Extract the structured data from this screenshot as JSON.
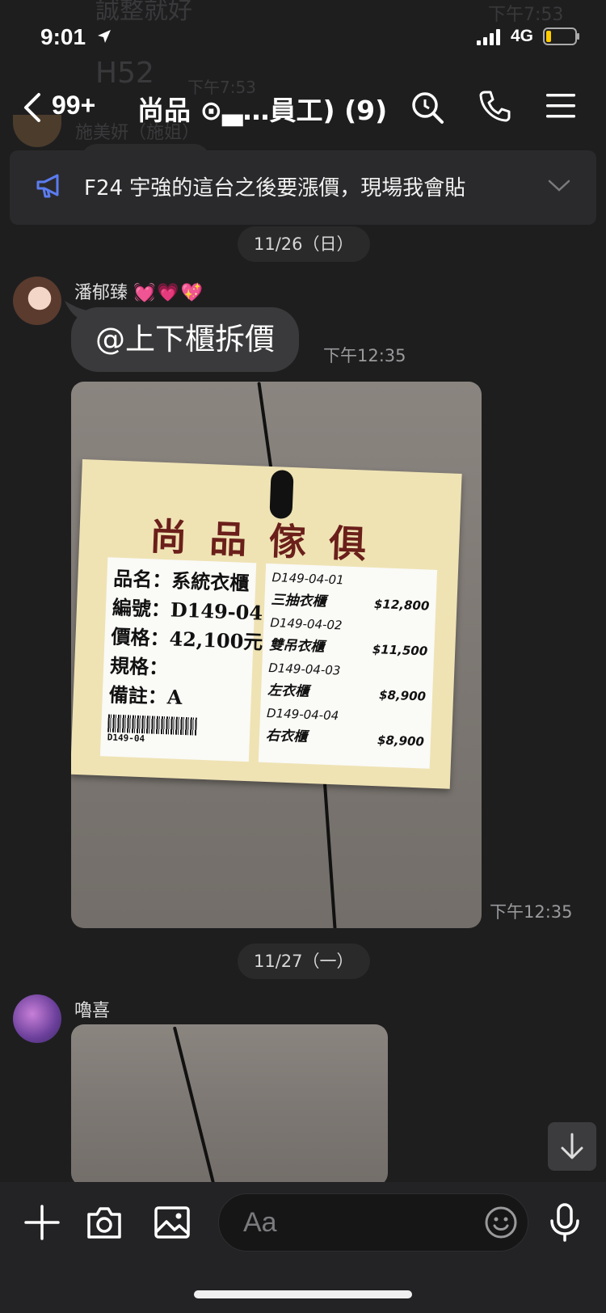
{
  "status_bar": {
    "time": "9:01",
    "network": "4G"
  },
  "ghost": {
    "line1": "誠整就好",
    "time1": "下午7:53",
    "line2": "H52",
    "time2": "下午7:53",
    "name": "施美妍（施姐）"
  },
  "nav": {
    "unread_count": "99+",
    "title": "尚品 ⊙▃…員工) (9)"
  },
  "announcement": {
    "text": "F24 宇強的這台之後要漲價，現場我會貼"
  },
  "dates": {
    "d1": "11/26（日）",
    "d2": "11/27（一）"
  },
  "messages": {
    "m1": {
      "sender": "潘郁臻",
      "hearts": "💓💗💖",
      "text": "@上下櫃拆價",
      "time": "下午12:35"
    },
    "m2": {
      "time": "下午12:35"
    },
    "m3": {
      "sender": "嚕喜"
    }
  },
  "photo_tag": {
    "brand": "尚品傢俱",
    "name_row": "品名：系統衣櫃",
    "code_row": "編號：D149-04",
    "price_row": "價格：42,100元",
    "spec_row": "規格：",
    "note_row": "備註：A",
    "barcode_text": "D149-04",
    "items": [
      {
        "code": "D149-04-01",
        "name": "三抽衣櫃",
        "price": "$12,800"
      },
      {
        "code": "D149-04-02",
        "name": "雙吊衣櫃",
        "price": "$11,500"
      },
      {
        "code": "D149-04-03",
        "name": "左衣櫃",
        "price": "$8,900"
      },
      {
        "code": "D149-04-04",
        "name": "右衣櫃",
        "price": "$8,900"
      }
    ]
  },
  "input": {
    "placeholder": "Aa"
  }
}
